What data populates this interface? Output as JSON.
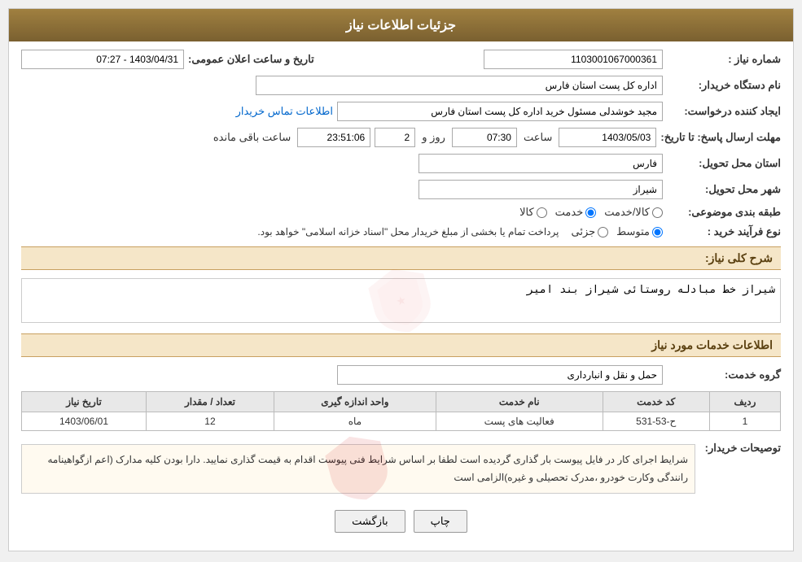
{
  "page": {
    "title": "جزئیات اطلاعات نیاز",
    "header_label": "جزئیات اطلاعات نیاز"
  },
  "fields": {
    "request_number_label": "شماره نیاز :",
    "request_number_value": "1103001067000361",
    "buyer_name_label": "نام دستگاه خریدار:",
    "buyer_name_value": "اداره کل پست استان فارس",
    "creator_label": "ایجاد کننده درخواست:",
    "creator_value": "مجید خوشدلی مسئول خرید اداره کل پست استان فارس",
    "contact_link": "اطلاعات تماس خریدار",
    "deadline_label": "مهلت ارسال پاسخ: تا تاریخ:",
    "deadline_date": "1403/05/03",
    "deadline_time_label": "ساعت",
    "deadline_time": "07:30",
    "deadline_days_label": "روز و",
    "deadline_days": "2",
    "deadline_remaining_label": "ساعت باقی مانده",
    "deadline_remaining": "23:51:06",
    "province_label": "استان محل تحویل:",
    "province_value": "فارس",
    "city_label": "شهر محل تحویل:",
    "city_value": "شیراز",
    "category_label": "طبقه بندی موضوعی:",
    "category_options": [
      {
        "label": "کالا",
        "value": "kala"
      },
      {
        "label": "خدمت",
        "value": "khedmat"
      },
      {
        "label": "کالا/خدمت",
        "value": "kala_khedmat"
      }
    ],
    "category_selected": "khedmat",
    "purchase_type_label": "نوع فرآیند خرید :",
    "purchase_type_options": [
      {
        "label": "جزئی",
        "value": "jozee"
      },
      {
        "label": "متوسط",
        "value": "motavaset"
      }
    ],
    "purchase_type_selected": "motavaset",
    "purchase_type_note": "پرداخت تمام یا بخشی از مبلغ خریدار محل \"اسناد خزانه اسلامی\" خواهد بود.",
    "description_label": "شرح کلی نیاز:",
    "description_value": "شیراز خط مبادله روستائی شیراز بند امیر",
    "services_section_label": "اطلاعات خدمات مورد نیاز",
    "service_group_label": "گروه خدمت:",
    "service_group_value": "حمل و نقل و انبارداری",
    "table": {
      "columns": [
        "ردیف",
        "کد خدمت",
        "نام خدمت",
        "واحد اندازه گیری",
        "تعداد / مقدار",
        "تاریخ نیاز"
      ],
      "rows": [
        {
          "row_num": "1",
          "service_code": "ح-53-531",
          "service_name": "فعالیت های پست",
          "unit": "ماه",
          "quantity": "12",
          "date": "1403/06/01"
        }
      ]
    },
    "buyer_notes_label": "توصیحات خریدار:",
    "buyer_notes": "شرایط اجرای کار در فایل پیوست بار گذاری گردیده است لطفا بر اساس شرایط فنی پیوست اقدام به قیمت گذاری نمایید. دارا بودن کلیه مدارک (اعم ازگواهینامه رانندگی وکارت خودرو ،مدرک تحصیلی و غیره)الزامی است",
    "buttons": {
      "back_label": "بازگشت",
      "print_label": "چاپ"
    },
    "public_announce_label": "تاریخ و ساعت اعلان عمومی:",
    "public_announce_value": "1403/04/31 - 07:27"
  }
}
